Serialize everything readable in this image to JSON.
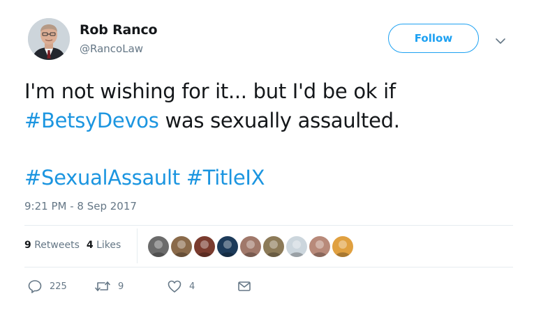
{
  "user": {
    "name": "Rob Ranco",
    "handle": "@RancoLaw"
  },
  "follow_button": {
    "label": "Follow"
  },
  "tweet": {
    "line1": "I'm not wishing for it... but I'd be ok if",
    "line2_hashtag": "#BetsyDevos",
    "line2_rest": " was sexually assaulted.",
    "hashtag1": "#SexualAssault",
    "hashtag2": "#TitleIX",
    "hashtag_color": "#1b95e0"
  },
  "timestamp": "9:21 PM - 8 Sep 2017",
  "stats": {
    "retweets_count": "9",
    "retweets_label": "Retweets",
    "likes_count": "4",
    "likes_label": "Likes"
  },
  "likers": [
    {
      "name": "liker-avatar-1",
      "color": "#6b6b6b"
    },
    {
      "name": "liker-avatar-2",
      "color": "#8a6a4a"
    },
    {
      "name": "liker-avatar-3",
      "color": "#7a3b2e"
    },
    {
      "name": "liker-avatar-4",
      "color": "#1d3b5a"
    },
    {
      "name": "liker-avatar-5",
      "color": "#a0786a"
    },
    {
      "name": "liker-avatar-6",
      "color": "#8c7a58"
    },
    {
      "name": "liker-avatar-7",
      "color": "#ccd6dd"
    },
    {
      "name": "liker-avatar-8",
      "color": "#b88a7a"
    },
    {
      "name": "liker-avatar-9",
      "color": "#e0a040"
    }
  ],
  "actions": {
    "reply_count": "225",
    "retweet_count": "9",
    "like_count": "4"
  },
  "icons": [
    "caret-down-icon",
    "reply-icon",
    "retweet-icon",
    "heart-icon",
    "mail-icon"
  ],
  "colors": {
    "brand_blue": "#1da1f2",
    "muted": "#657786",
    "text": "#14171a"
  }
}
